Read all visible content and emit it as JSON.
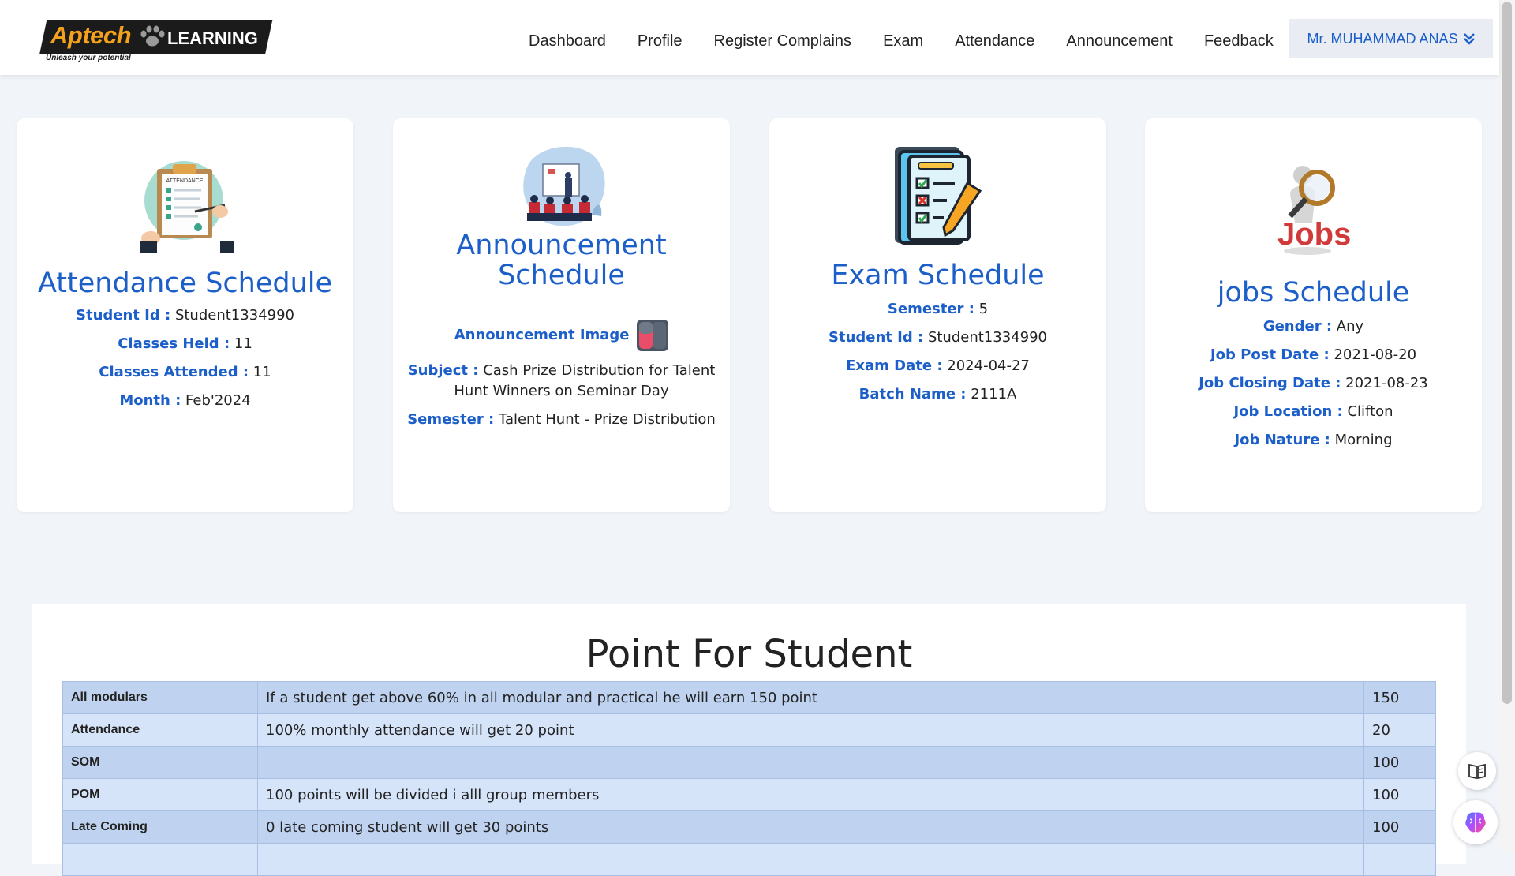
{
  "header": {
    "logo": {
      "brand": "Aptech",
      "learning": "LEARNING",
      "tagline": "Unleash your potential"
    },
    "nav": [
      "Dashboard",
      "Profile",
      "Register Complains",
      "Exam",
      "Attendance",
      "Announcement",
      "Feedback"
    ],
    "user": "Mr. MUHAMMAD ANAS"
  },
  "cards": {
    "attendance": {
      "title": "Attendance Schedule",
      "illustration_icon": "attendance-clipboard-icon",
      "illustration_text": "ATTENDANCE",
      "rows": [
        {
          "label": "Student Id :",
          "value": "Student1334990"
        },
        {
          "label": "Classes Held :",
          "value": "11"
        },
        {
          "label": "Classes Attended :",
          "value": "11"
        },
        {
          "label": "Month :",
          "value": "Feb'2024"
        }
      ]
    },
    "announcement": {
      "title": "Announcement Schedule",
      "image_label": "Announcement Image",
      "rows": [
        {
          "label": "Subject :",
          "value": "Cash Prize Distribution for Talent Hunt Winners on Seminar Day"
        },
        {
          "label": "Semester :",
          "value": "Talent Hunt - Prize Distribution"
        }
      ]
    },
    "exam": {
      "title": "Exam Schedule",
      "rows": [
        {
          "label": "Semester :",
          "value": "5"
        },
        {
          "label": "Student Id :",
          "value": "Student1334990"
        },
        {
          "label": "Exam Date :",
          "value": "2024-04-27"
        },
        {
          "label": "Batch Name :",
          "value": "2111A"
        }
      ]
    },
    "jobs": {
      "title": "jobs Schedule",
      "illustration_text": "Jobs",
      "rows": [
        {
          "label": "Gender :",
          "value": "Any"
        },
        {
          "label": "Job Post Date :",
          "value": "2021-08-20"
        },
        {
          "label": "Job Closing Date :",
          "value": "2021-08-23"
        },
        {
          "label": "Job Location :",
          "value": "Clifton"
        },
        {
          "label": "Job Nature :",
          "value": "Morning"
        }
      ]
    }
  },
  "points": {
    "title": "Point For Student",
    "rows": [
      {
        "name": "All modulars",
        "desc": "If a student get above 60% in all modular and practical he will earn 150 point",
        "points": "150"
      },
      {
        "name": "Attendance",
        "desc": "100% monthly attendance will get 20 point",
        "points": "20"
      },
      {
        "name": "SOM",
        "desc": "",
        "points": "100"
      },
      {
        "name": "POM",
        "desc": "100 points will be divided i alll group members",
        "points": "100"
      },
      {
        "name": "Late Coming",
        "desc": "0 late coming student will get 30 points",
        "points": "100"
      }
    ]
  },
  "colors": {
    "accent": "#1c5fc9",
    "row_odd": "#bfd3f0",
    "row_even": "#d6e4f9",
    "background": "#f1f4f9"
  }
}
